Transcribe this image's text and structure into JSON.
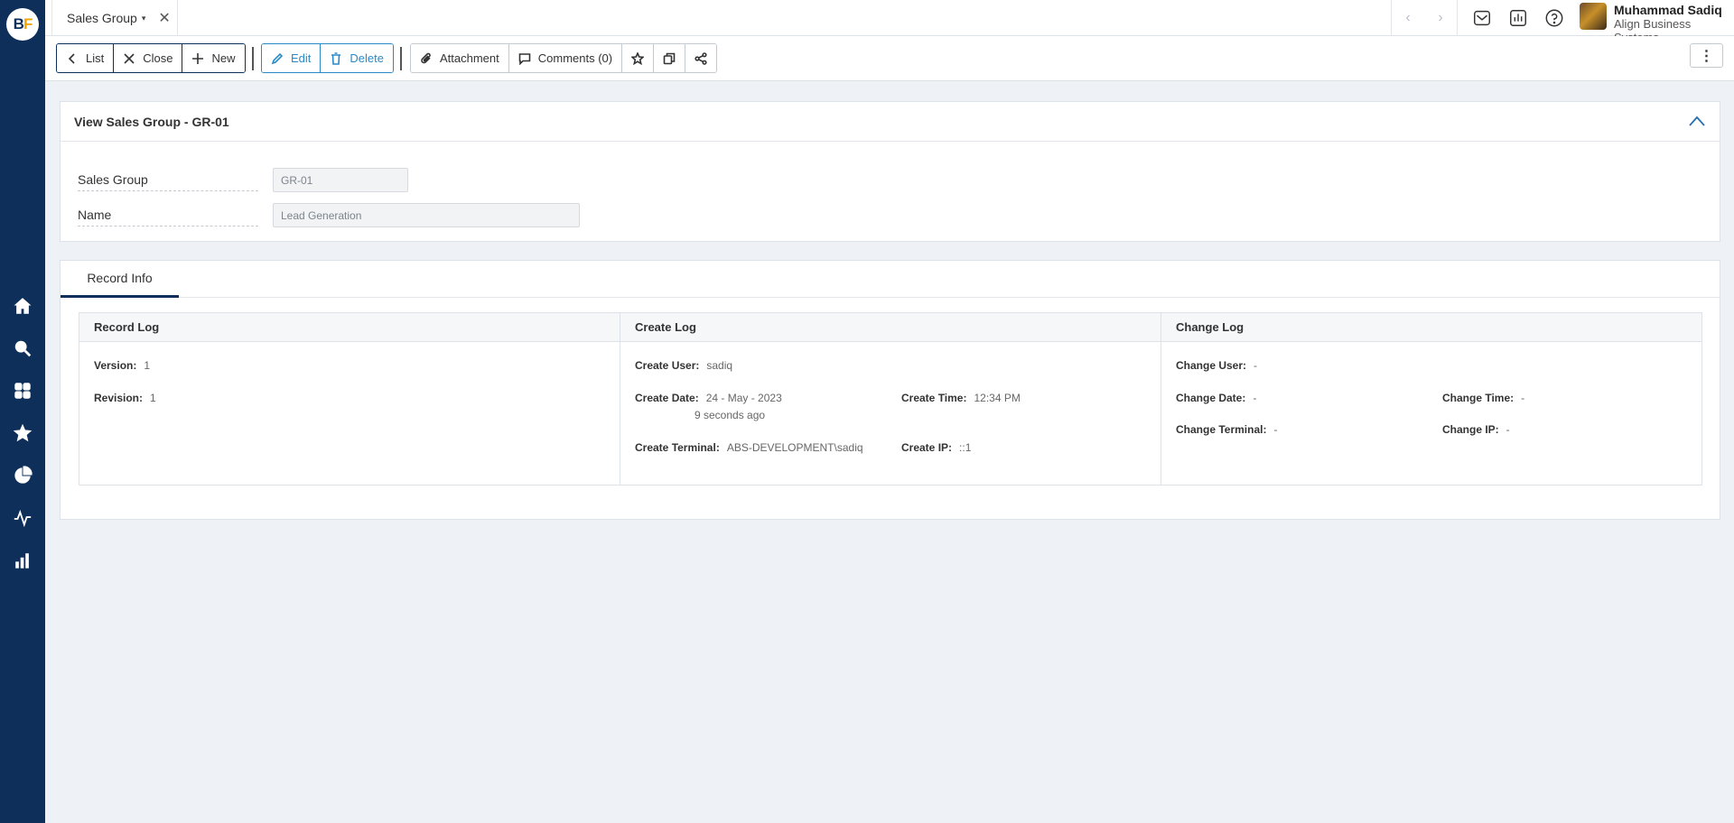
{
  "app": {
    "logo_b": "B",
    "logo_f": "F"
  },
  "sidebar": {
    "icons": [
      "home-icon",
      "search-icon",
      "grid-icon",
      "star-icon",
      "pie-chart-icon",
      "activity-icon",
      "bar-chart-icon"
    ]
  },
  "tab": {
    "label": "Sales Group",
    "caret": "▾",
    "close": "✕"
  },
  "nav": {
    "prev": "‹",
    "next": "›"
  },
  "user": {
    "name": "Muhammad Sadiq",
    "org": "Align Business Systems"
  },
  "toolbar": {
    "list_label": "List",
    "close_label": "Close",
    "new_label": "New",
    "edit_label": "Edit",
    "delete_label": "Delete",
    "attachment_label": "Attachment",
    "comments_label": "Comments (0)",
    "more": "⋮"
  },
  "form": {
    "title": "View Sales Group - GR-01",
    "fields": [
      {
        "label": "Sales Group",
        "value": "GR-01"
      },
      {
        "label": "Name",
        "value": "Lead Generation"
      }
    ]
  },
  "record_tab": {
    "label": "Record Info"
  },
  "record_log": {
    "title": "Record Log",
    "version_label": "Version:",
    "version": "1",
    "revision_label": "Revision:",
    "revision": "1"
  },
  "create_log": {
    "title": "Create Log",
    "user_label": "Create User:",
    "user": "sadiq",
    "date_label": "Create Date:",
    "date": "24 - May - 2023",
    "date_ago": "9 seconds ago",
    "time_label": "Create Time:",
    "time": "12:34 PM",
    "terminal_label": "Create Terminal:",
    "terminal": "ABS-DEVELOPMENT\\sadiq",
    "ip_label": "Create IP:",
    "ip": "::1"
  },
  "change_log": {
    "title": "Change Log",
    "user_label": "Change User:",
    "user": "-",
    "date_label": "Change Date:",
    "date": "-",
    "time_label": "Change Time:",
    "time": "-",
    "terminal_label": "Change Terminal:",
    "terminal": "-",
    "ip_label": "Change IP:",
    "ip": "-"
  }
}
